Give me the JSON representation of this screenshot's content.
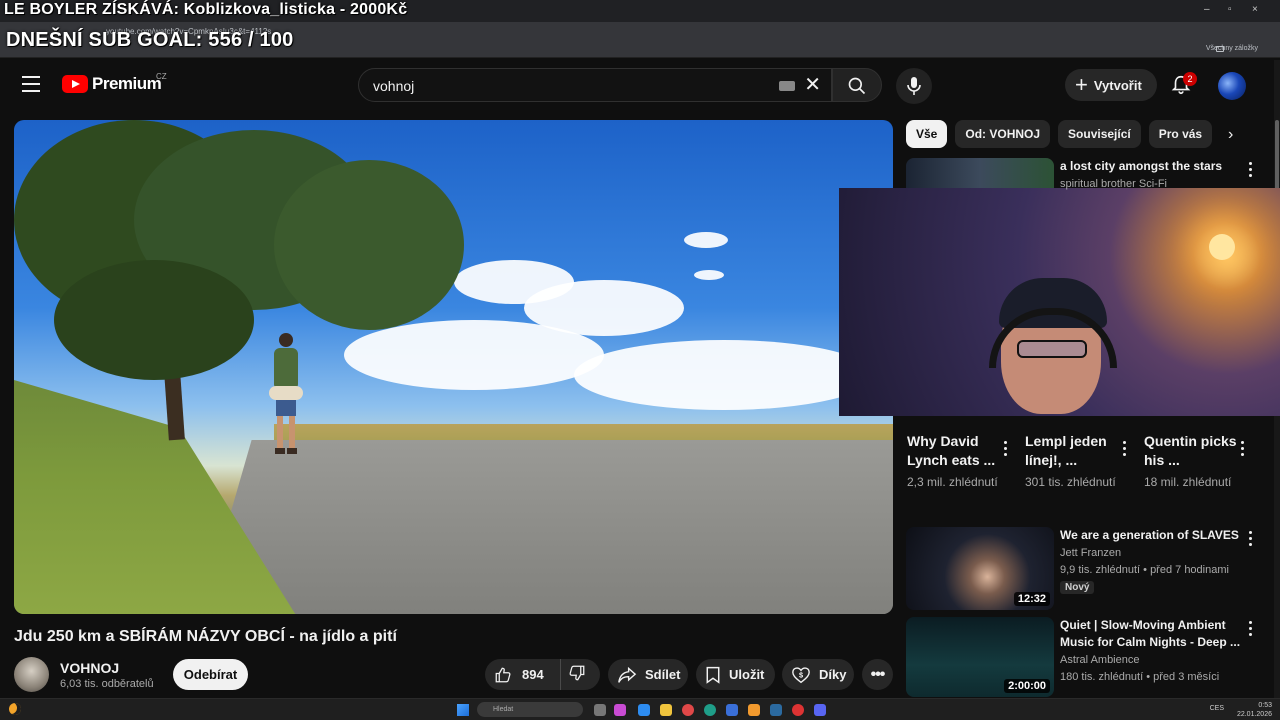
{
  "browser": {
    "url": "youtube.com/watch?v=CpmkpAsIu3c&t=4112s",
    "bookmarks_label": "Všechny záložky",
    "window_controls": [
      "–",
      "▫",
      "×"
    ]
  },
  "overlay": {
    "donation": "LE BOYLER ZÍSKÁVÁ: Koblizkova_listicka - 2000Kč",
    "sub_goal": "DNEŠNÍ SUB GOAL: 556 / 100"
  },
  "header": {
    "logo_text": "Premium",
    "country_code": "CZ",
    "search_value": "vohnoj",
    "create_label": "Vytvořit",
    "notification_count": "2"
  },
  "video": {
    "title": "Jdu 250 km a SBÍRÁM NÁZVY OBCÍ - na jídlo a pití",
    "channel": {
      "name": "VOHNOJ",
      "subscribers": "6,03 tis. odběratelů"
    },
    "subscribe_label": "Odebírat",
    "like_count": "894",
    "share_label": "Sdílet",
    "save_label": "Uložit",
    "thanks_label": "Díky",
    "more_label": "•••"
  },
  "sidebar": {
    "chips": [
      "Vše",
      "Od: VOHNOJ",
      "Související",
      "Pro vás"
    ],
    "top_rec": {
      "title": "a lost city amongst the stars",
      "channel": "spiritual brother Sci-Fi"
    },
    "shorts": [
      {
        "title": "Why David Lynch eats ...",
        "views": "2,3 mil. zhlédnutí"
      },
      {
        "title": "Lempl jeden línej!, ...",
        "views": "301 tis. zhlédnutí"
      },
      {
        "title": "Quentin picks his ...",
        "views": "18 mil. zhlédnutí"
      }
    ],
    "recs": [
      {
        "title": "We are a generation of SLAVES",
        "channel": "Jett Franzen",
        "meta": "9,9 tis. zhlédnutí • před 7 hodinami",
        "badge": "Nový",
        "duration": "12:32"
      },
      {
        "title": "Quiet | Slow-Moving Ambient Music for Calm Nights - Deep ...",
        "channel": "Astral Ambience",
        "meta": "180 tis. zhlédnutí • před 3 měsíci",
        "duration": "2:00:00"
      }
    ]
  },
  "taskbar": {
    "search_placeholder": "Hledat",
    "tray_lang": "CES",
    "time": "0:53",
    "date": "22.01.2026"
  },
  "colors": {
    "background": "#0f0f0f",
    "brand_red": "#ff0000",
    "badge_red": "#cc0000",
    "chip_bg": "#272727"
  },
  "icons": [
    "menu-icon",
    "youtube-logo-icon",
    "keyboard-icon",
    "close-icon",
    "search-icon",
    "mic-icon",
    "plus-icon",
    "bell-icon",
    "like-icon",
    "dislike-icon",
    "share-icon",
    "bookmark-icon",
    "thanks-icon",
    "more-icon",
    "chevron-right-icon",
    "windows-icon"
  ]
}
